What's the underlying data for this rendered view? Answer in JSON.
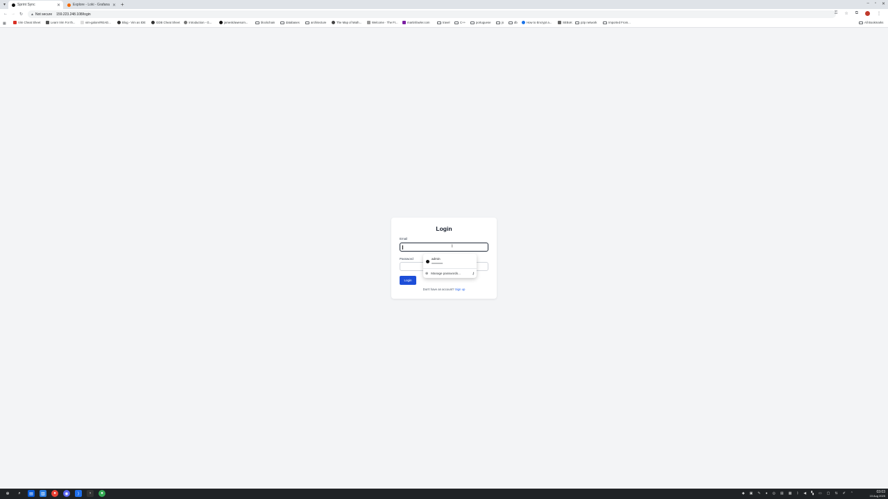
{
  "browser": {
    "tabs": [
      {
        "title": "Sprint Sync",
        "active": true
      },
      {
        "title": "Explore - Loki - Grafana",
        "active": false
      }
    ],
    "address": {
      "security_label": "Not secure",
      "url": "159.223.248.108/login"
    },
    "bookmarks": [
      {
        "label": "Vim Cheat Sheet",
        "icon": "vim-icon"
      },
      {
        "label": "Learn Vim For th...",
        "icon": "vim-icon"
      },
      {
        "label": "vim-galore/READ...",
        "icon": "page-icon"
      },
      {
        "label": "Blog - Vim as IDE",
        "icon": "page-icon"
      },
      {
        "label": "GDB Cheat Sheet",
        "icon": "page-icon"
      },
      {
        "label": "Introduction - G...",
        "icon": "page-icon"
      },
      {
        "label": "jamesk/awesom...",
        "icon": "github-icon"
      },
      {
        "label": "blockchain",
        "icon": "folder-icon"
      },
      {
        "label": "databases",
        "icon": "folder-icon"
      },
      {
        "label": "architecture",
        "icon": "folder-icon"
      },
      {
        "label": "The Map of Math...",
        "icon": "page-icon"
      },
      {
        "label": "Welcome · The FI...",
        "icon": "page-icon"
      },
      {
        "label": "martinfowler.com",
        "icon": "page-icon"
      },
      {
        "label": "travel",
        "icon": "folder-icon"
      },
      {
        "label": "C++",
        "icon": "folder-icon"
      },
      {
        "label": "portuguese",
        "icon": "folder-icon"
      },
      {
        "label": "js",
        "icon": "folder-icon"
      },
      {
        "label": "db",
        "icon": "folder-icon"
      },
      {
        "label": "How to Encrypt a...",
        "icon": "page-icon"
      },
      {
        "label": "SEBoK",
        "icon": "page-icon"
      },
      {
        "label": "p2p network",
        "icon": "folder-icon"
      },
      {
        "label": "Imported From...",
        "icon": "folder-icon"
      }
    ],
    "all_bookmarks": "All Bookmarks"
  },
  "login": {
    "title": "Login",
    "email_label": "Email",
    "email_value": "",
    "password_label": "Password",
    "password_value": "",
    "button": "Login",
    "signup_prompt": "Don't have an account?",
    "signup_link": "Sign up"
  },
  "autofill": {
    "username": "admin",
    "password_mask": "••••••••••••••••",
    "manage": "Manage passwords..."
  },
  "taskbar": {
    "time": "03:03",
    "date": "15 Aug 2025"
  },
  "colors": {
    "page_bg": "#f3f4f6",
    "primary_button": "#1d4ed8",
    "link": "#2563eb",
    "taskbar": "#1f2225"
  }
}
